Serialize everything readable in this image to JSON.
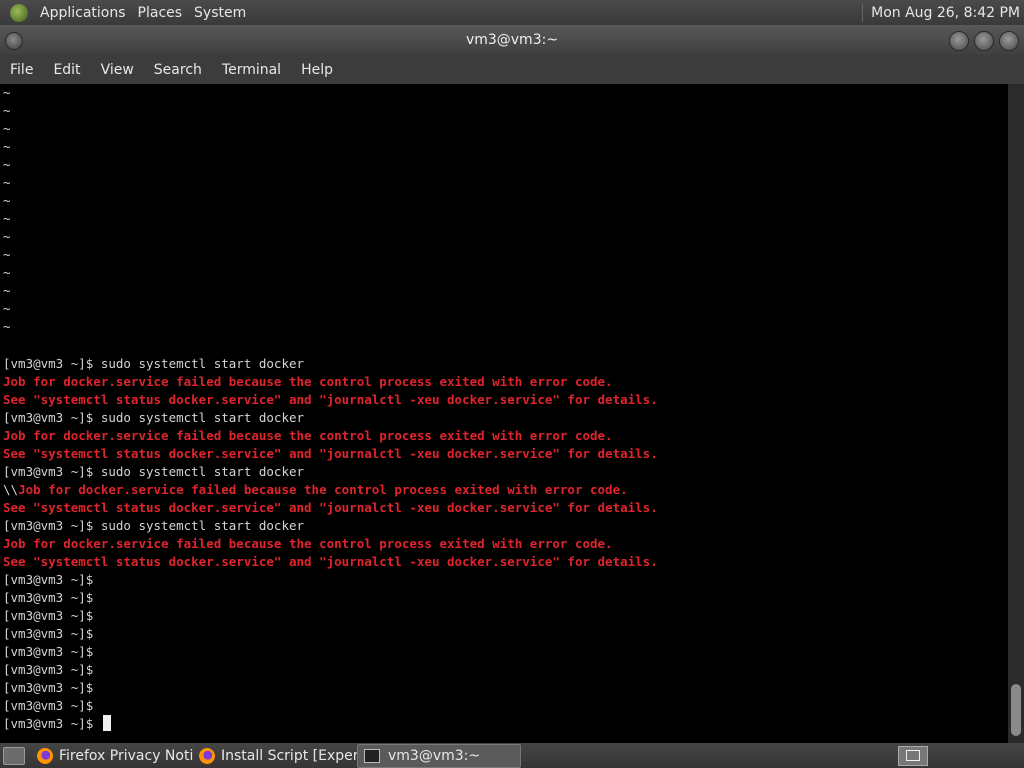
{
  "top_panel": {
    "menus": [
      "Applications",
      "Places",
      "System"
    ],
    "clock": "Mon Aug 26,  8:42 PM"
  },
  "window": {
    "title": "vm3@vm3:~"
  },
  "menubar": [
    "File",
    "Edit",
    "View",
    "Search",
    "Terminal",
    "Help"
  ],
  "terminal": {
    "tildes": [
      "~",
      "~",
      "~",
      "~",
      "~",
      "~",
      "~",
      "~",
      "~",
      "~",
      "~",
      "~",
      "~",
      "~"
    ],
    "lines": [
      {
        "text": "[vm3@vm3 ~]$ sudo systemctl start docker",
        "type": "cmd"
      },
      {
        "text": "Job for docker.service failed because the control process exited with error code.",
        "type": "err"
      },
      {
        "text": "See \"systemctl status docker.service\" and \"journalctl -xeu docker.service\" for details.",
        "type": "err"
      },
      {
        "text": "[vm3@vm3 ~]$ sudo systemctl start docker",
        "type": "cmd"
      },
      {
        "text": "Job for docker.service failed because the control process exited with error code.",
        "type": "err"
      },
      {
        "text": "See \"systemctl status docker.service\" and \"journalctl -xeu docker.service\" for details.",
        "type": "err"
      },
      {
        "text": "[vm3@vm3 ~]$ sudo systemctl start docker",
        "type": "cmd"
      },
      {
        "prefix": "\\\\",
        "text": "Job for docker.service failed because the control process exited with error code.",
        "type": "err"
      },
      {
        "text": "See \"systemctl status docker.service\" and \"journalctl -xeu docker.service\" for details.",
        "type": "err"
      },
      {
        "text": "[vm3@vm3 ~]$ sudo systemctl start docker",
        "type": "cmd"
      },
      {
        "text": "Job for docker.service failed because the control process exited with error code.",
        "type": "err"
      },
      {
        "text": "See \"systemctl status docker.service\" and \"journalctl -xeu docker.service\" for details.",
        "type": "err"
      },
      {
        "text": "[vm3@vm3 ~]$",
        "type": "cmd"
      },
      {
        "text": "[vm3@vm3 ~]$",
        "type": "cmd"
      },
      {
        "text": "[vm3@vm3 ~]$",
        "type": "cmd"
      },
      {
        "text": "[vm3@vm3 ~]$",
        "type": "cmd"
      },
      {
        "text": "[vm3@vm3 ~]$",
        "type": "cmd"
      },
      {
        "text": "[vm3@vm3 ~]$",
        "type": "cmd"
      },
      {
        "text": "[vm3@vm3 ~]$",
        "type": "cmd"
      },
      {
        "text": "[vm3@vm3 ~]$",
        "type": "cmd"
      },
      {
        "text": "[vm3@vm3 ~]$ ",
        "type": "prompt-active"
      }
    ],
    "colors": {
      "error": "#e0242c",
      "text": "#d4d4d4",
      "background": "#000000"
    }
  },
  "taskbar": {
    "tasks": [
      {
        "label": "Firefox Privacy Notic...",
        "icon": "firefox-icon",
        "active": false
      },
      {
        "label": "Install Script [Experi...",
        "icon": "firefox-icon",
        "active": false
      },
      {
        "label": "vm3@vm3:~",
        "icon": "terminal-icon",
        "active": true
      }
    ]
  }
}
